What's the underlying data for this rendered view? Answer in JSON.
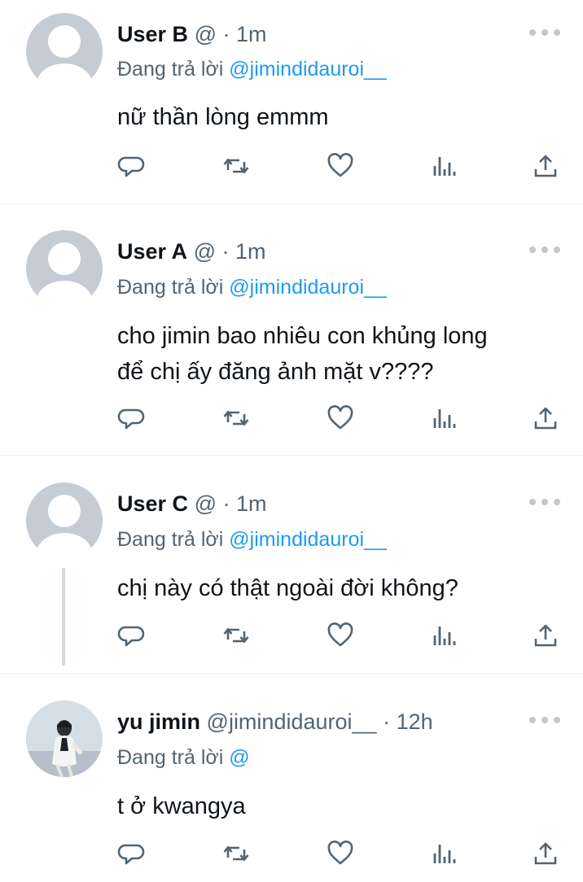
{
  "tweets": [
    {
      "name": "User B",
      "handle": "@",
      "separator": "·",
      "time": "1m",
      "reply_prefix": "Đang trả lời",
      "reply_handle": "@jimindidauroi__",
      "text": [
        "nữ thần lòng emmm"
      ]
    },
    {
      "name": "User A",
      "handle": "@",
      "separator": "·",
      "time": "1m",
      "reply_prefix": "Đang trả lời",
      "reply_handle": "@jimindidauroi__",
      "text": [
        "cho jimin bao nhiêu con khủng long",
        "để chị ấy đăng ảnh mặt v????"
      ]
    },
    {
      "name": "User C",
      "handle": "@",
      "separator": "·",
      "time": "1m",
      "reply_prefix": "Đang trả lời",
      "reply_handle": "@jimindidauroi__",
      "text": [
        "chị này có thật ngoài đời không?"
      ]
    },
    {
      "name": "yu jimin",
      "handle": "@jimindidauroi__",
      "separator": "·",
      "time": "12h",
      "reply_prefix": "Đang trả lời",
      "reply_handle": "@",
      "text": [
        "t ở kwangya"
      ]
    }
  ],
  "icons": {
    "reply": "reply-icon",
    "retweet": "retweet-icon",
    "like": "like-icon",
    "views": "views-icon",
    "share": "share-icon",
    "more": "more-icon"
  },
  "colors": {
    "link": "#1d9bf0",
    "secondary_text": "#536471",
    "icon": "#536471",
    "default_avatar": "#c5ccd3"
  }
}
